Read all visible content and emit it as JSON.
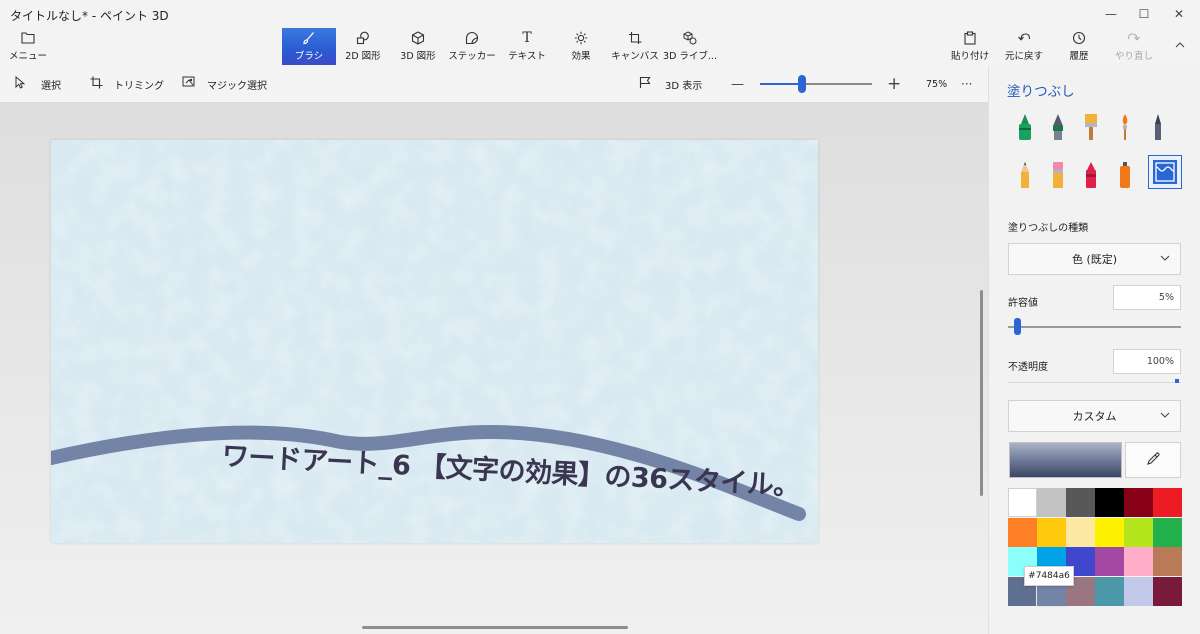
{
  "window": {
    "title": "タイトルなし* - ペイント 3D",
    "minimize": "—",
    "maximize": "☐",
    "close": "✕"
  },
  "toolbar": {
    "menu": "メニュー",
    "brushes": "ブラシ",
    "shapes2d": "2D 図形",
    "shapes3d": "3D 図形",
    "stickers": "ステッカー",
    "text": "テキスト",
    "effects": "効果",
    "canvas": "キャンバス",
    "library3d": "3D ライブ...",
    "paste": "貼り付け",
    "undo": "元に戻す",
    "history": "履歴",
    "redo": "やり直し"
  },
  "subbar": {
    "select": "選択",
    "crop": "トリミング",
    "magic_select": "マジック選択",
    "view3d": "3D 表示",
    "zoom_minus": "—",
    "zoom_plus": "+",
    "zoom": "75%",
    "more": "···"
  },
  "canvas": {
    "wordart": "ワードアート_6 【文字の効果】の36スタイル。",
    "stroke_color": "#7484a6"
  },
  "panel": {
    "title": "塗りつぶし",
    "fill_type_label": "塗りつぶしの種類",
    "fill_type_value": "色 (既定)",
    "tolerance_label": "許容値",
    "tolerance_value": "5%",
    "tolerance_level": 0.05,
    "opacity_label": "不透明度",
    "opacity_value": "100%",
    "color_mode": "カスタム",
    "tooltip": "#7484a6",
    "selected_color": "#7484a6"
  },
  "palette": [
    "#ffffff",
    "#c3c3c3",
    "#585858",
    "#000000",
    "#880015",
    "#ed1c24",
    "#ff7f27",
    "#ffc90e",
    "#fde8a3",
    "#fff200",
    "#b5e61d",
    "#22b14c",
    "#8cfffb",
    "#00a2e8",
    "#3f48cc",
    "#a349a4",
    "#ffaec9",
    "#b97a57",
    "#5f6f8f",
    "#7484a6",
    "#9a7682",
    "#4a98a8",
    "#c2c8e8",
    "#7a1a3a"
  ],
  "icons": {
    "menu": "folder-icon",
    "brushes": "brush-icon",
    "shapes2d": "shapes-2d-icon",
    "shapes3d": "cube-icon",
    "stickers": "sticker-icon",
    "text": "text-icon",
    "effects": "sun-icon",
    "canvas": "crop-canvas-icon",
    "library3d": "library-3d-icon",
    "paste": "paste-icon",
    "undo": "undo-icon",
    "history": "history-icon",
    "redo": "redo-icon",
    "select": "cursor-icon",
    "crop": "crop-icon",
    "magic_select": "magic-select-icon",
    "view3d": "flag-icon",
    "picker": "eyedropper-icon"
  }
}
